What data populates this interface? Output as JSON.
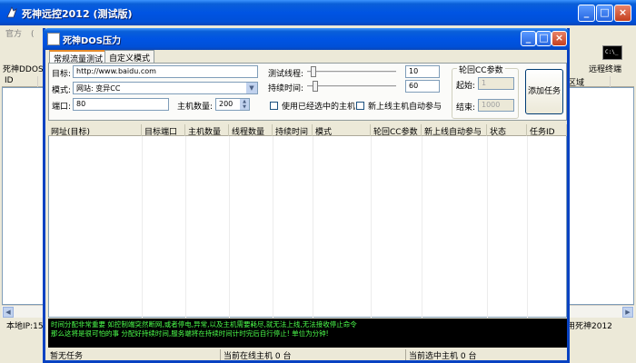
{
  "bg_window": {
    "title": "死神远控2012 (测试版)",
    "menu": [
      "官方",
      "(",
      "D)"
    ],
    "left_label": "死神DDOS",
    "remote_terminal": "远程终端",
    "list_header_left": "ID",
    "list_header_region": "区域",
    "status_left": "本地IP:15",
    "status_right": "用死神2012"
  },
  "dos_window": {
    "title": "死神DOS压力",
    "tabs": [
      "常规流量测试",
      "自定义模式"
    ],
    "target_label": "目标:",
    "target_value": "http://www.baidu.com",
    "mode_label": "模式:",
    "mode_value": "网站: 变异CC",
    "port_label": "端口:",
    "port_value": "80",
    "host_count_label": "主机数量:",
    "host_count_value": "200",
    "thread_label": "测试线程:",
    "thread_value": "10",
    "duration_label": "持续时间:",
    "duration_value": "60",
    "use_selected_label": "使用已经选中的主机",
    "auto_join_label": "新上线主机自动参与",
    "rotation_group": "轮回CC参数",
    "start_label": "起始:",
    "start_value": "1",
    "end_label": "结束:",
    "end_value": "1000",
    "add_task_button": "添加任务",
    "columns": [
      "网址(目标)",
      "目标端口",
      "主机数量",
      "线程数量",
      "持续时间",
      "模式",
      "轮回CC参数",
      "新上线自动参与",
      "状态",
      "任务ID"
    ],
    "log_lines": [
      "时间分配非常重要 如控制端突然断网,或者停电,异常,以及主机需要耗尽,就无法上线,无法接收停止命令",
      "那么这将是很可怕的事 分配好持续时间,服务端将在持续时间计时完后自行停止! 单位为分钟!"
    ],
    "status_task": "暂无任务",
    "status_online": "当前在线主机 0 台",
    "status_selected": "当前选中主机 0 台"
  }
}
